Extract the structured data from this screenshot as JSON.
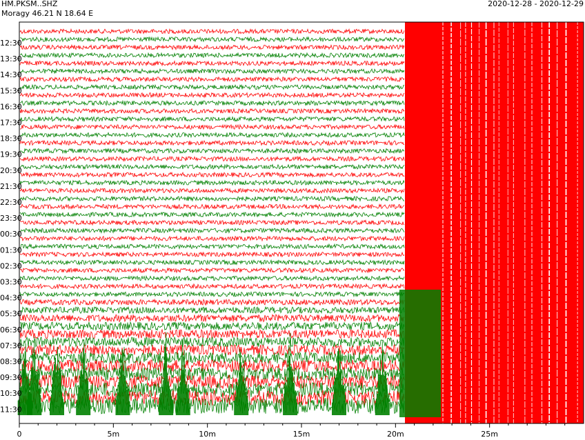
{
  "header": {
    "station": "HM.PKSM..SHZ",
    "location": "Moragy  46.21 N 18.64 E",
    "date_range": "2020-12-28 - 2020-12-29"
  },
  "colors": {
    "red_trace": "#ff0000",
    "green_trace": "#008000",
    "frame": "#000000"
  },
  "chart_data": {
    "type": "line",
    "title": "",
    "xlabel": "",
    "ylabel": "",
    "x_unit": "minutes",
    "xlim": [
      0,
      30
    ],
    "x_ticks": [
      {
        "value": 0,
        "label": "0"
      },
      {
        "value": 5,
        "label": "5m"
      },
      {
        "value": 10,
        "label": "10m"
      },
      {
        "value": 15,
        "label": "15m"
      },
      {
        "value": 20,
        "label": "20m"
      },
      {
        "value": 25,
        "label": "25m"
      }
    ],
    "row_labels": [
      "12:30",
      "13:30",
      "14:30",
      "15:30",
      "16:30",
      "17:30",
      "18:30",
      "19:30",
      "20:30",
      "21:30",
      "22:30",
      "23:30",
      "00:30",
      "01:30",
      "02:30",
      "03:30",
      "04:30",
      "05:30",
      "06:30",
      "07:30",
      "08:30",
      "09:30",
      "10:30",
      "11:30"
    ],
    "series": [
      {
        "color": "#ff0000",
        "pattern": "alternating half-hour lines starting at top"
      },
      {
        "color": "#008000",
        "pattern": "alternating half-hour lines"
      }
    ],
    "events": [
      {
        "type": "large earthquake signal",
        "start_minute": 20.5,
        "description": "saturated trace from 20.5m through end of record on all lines after event"
      }
    ],
    "grid": false
  }
}
